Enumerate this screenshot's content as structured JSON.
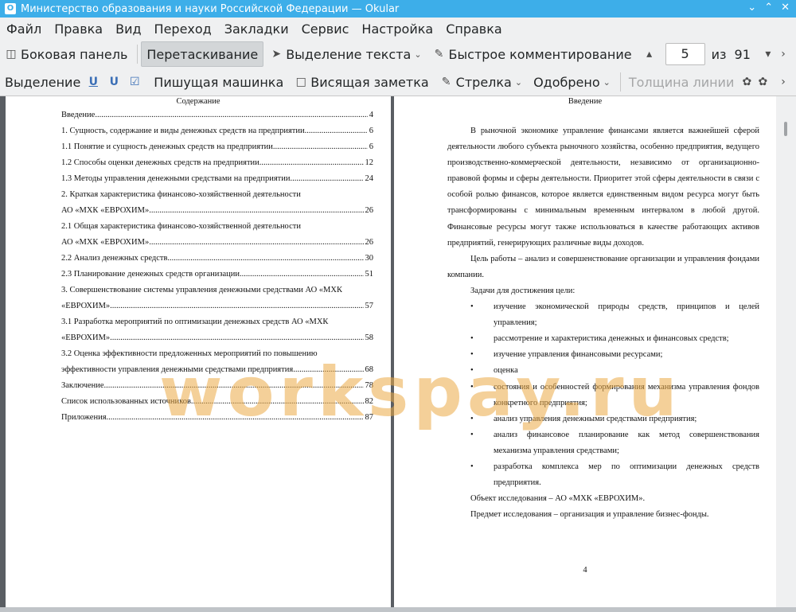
{
  "window": {
    "title": "Министерство образования и науки Российской Федерации  — Okular"
  },
  "menu": [
    "Файл",
    "Правка",
    "Вид",
    "Переход",
    "Закладки",
    "Сервис",
    "Настройка",
    "Справка"
  ],
  "toolbar1": {
    "sidebar": "Боковая панель",
    "drag": "Перетаскивание",
    "text_select": "Выделение текста",
    "quick_comment": "Быстрое комментирование",
    "page_current": "5",
    "page_of": "из",
    "page_total": "91"
  },
  "toolbar2": {
    "selection": "Выделение",
    "typewriter": "Пишущая машинка",
    "popup_note": "Висящая заметка",
    "arrow": "Стрелка",
    "stamp": "Одобрено",
    "line_width": "Толщина линии"
  },
  "page1": {
    "heading": "Содержание",
    "toc": [
      {
        "text": "Введение",
        "page": "4"
      },
      {
        "text": "1. Сущность, содержание и виды денежных средств на предприятии",
        "page": "6"
      },
      {
        "text": "1.1 Понятие и сущность денежных средств на предприятии",
        "page": "6"
      },
      {
        "text": "1.2 Способы оценки денежных средств на предприятии",
        "page": "12"
      },
      {
        "text": "1.3 Методы управления денежными средствами на предприятии",
        "page": "24"
      },
      {
        "text": "2.        Краткая        характеристика        финансово-хозяйственной        деятельности",
        "page": ""
      },
      {
        "text": "АО «МХК «ЕВРОХИМ»",
        "page": "26"
      },
      {
        "text": "2.1        Общая        характеристика        финансово-хозяйственной        деятельности",
        "page": ""
      },
      {
        "text": "АО «МХК «ЕВРОХИМ»",
        "page": "26"
      },
      {
        "text": "2.2 Анализ денежных средств",
        "page": "30"
      },
      {
        "text": "2.3 Планирование денежных средств организации",
        "page": "51"
      },
      {
        "text": "3. Совершенствование системы управления денежными средствами АО «МХК",
        "page": ""
      },
      {
        "text": "«ЕВРОХИМ»",
        "page": "57"
      },
      {
        "text": "3.1 Разработка мероприятий по оптимизации денежных средств АО «МХК",
        "page": ""
      },
      {
        "text": "«ЕВРОХИМ»",
        "page": "58"
      },
      {
        "text": "3.2 Оценка эффективности предложенных мероприятий по повышению",
        "page": ""
      },
      {
        "text": "эффективности управления денежными средствами предприятия",
        "page": "68"
      },
      {
        "text": "Заключение",
        "page": "78"
      },
      {
        "text": "Список использованных источников",
        "page": "82"
      },
      {
        "text": "Приложения",
        "page": "87"
      }
    ]
  },
  "page2": {
    "heading": "Введение",
    "para1": "В рыночной экономике управление финансами является важнейшей сферой деятельности любого субъекта рыночного хозяйства, особенно предприятия, ведущего производственно-коммерческой деятельности, независимо от организационно-правовой формы и сферы деятельности. Приоритет этой сферы деятельности в связи с особой ролью финансов, которое является единственным видом ресурса могут быть трансформированы с минимальным временным интервалом в любой другой. Финансовые ресурсы могут также использоваться в качестве работающих активов предприятий, генерирующих различные виды доходов.",
    "para2": "Цель работы – анализ и совершенствование организации и управления фондами компании.",
    "tasks_label": "Задачи для достижения цели:",
    "bullets": [
      "изучение экономической природы средств, принципов и целей управления;",
      "рассмотрение и характеристика денежных и финансовых средств;",
      "изучение управления финансовыми ресурсами;",
      "оценка",
      "состояния и особенностей формирования механизма управления фондов конкретного предприятия;",
      "анализ управления денежными средствами предприятия;",
      "анализ финансовое планирование как метод совершенствования механизма управления средствами;",
      "разработка комплекса мер по оптимизации денежных средств предприятия."
    ],
    "object": "Объект исследования – АО «МХК «ЕВРОХИМ».",
    "subject": "Предмет исследования – организация и управление бизнес-фонды.",
    "page_number": "4"
  },
  "watermark": "workspay.ru"
}
